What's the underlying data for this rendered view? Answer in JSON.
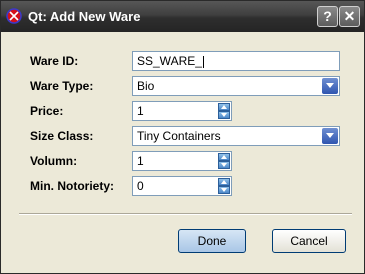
{
  "window": {
    "title": "Qt: Add New Ware",
    "help_glyph": "?",
    "close_glyph": "✕",
    "app_icon": "qt-logo-icon"
  },
  "form": {
    "ware_id": {
      "label": "Ware ID:",
      "value": "SS_WARE_"
    },
    "ware_type": {
      "label": "Ware Type:",
      "value": "Bio"
    },
    "price": {
      "label": "Price:",
      "value": "1"
    },
    "size_class": {
      "label": "Size Class:",
      "value": "Tiny Containers"
    },
    "volumn": {
      "label": "Volumn:",
      "value": "1"
    },
    "min_notoriety": {
      "label": "Min. Notoriety:",
      "value": "0"
    }
  },
  "buttons": {
    "done": "Done",
    "cancel": "Cancel"
  },
  "colors": {
    "titlebar": "#2e2e2e",
    "dialog_bg": "#ece9d8",
    "field_border": "#7f9db9",
    "default_button": "#a9c6e6"
  }
}
